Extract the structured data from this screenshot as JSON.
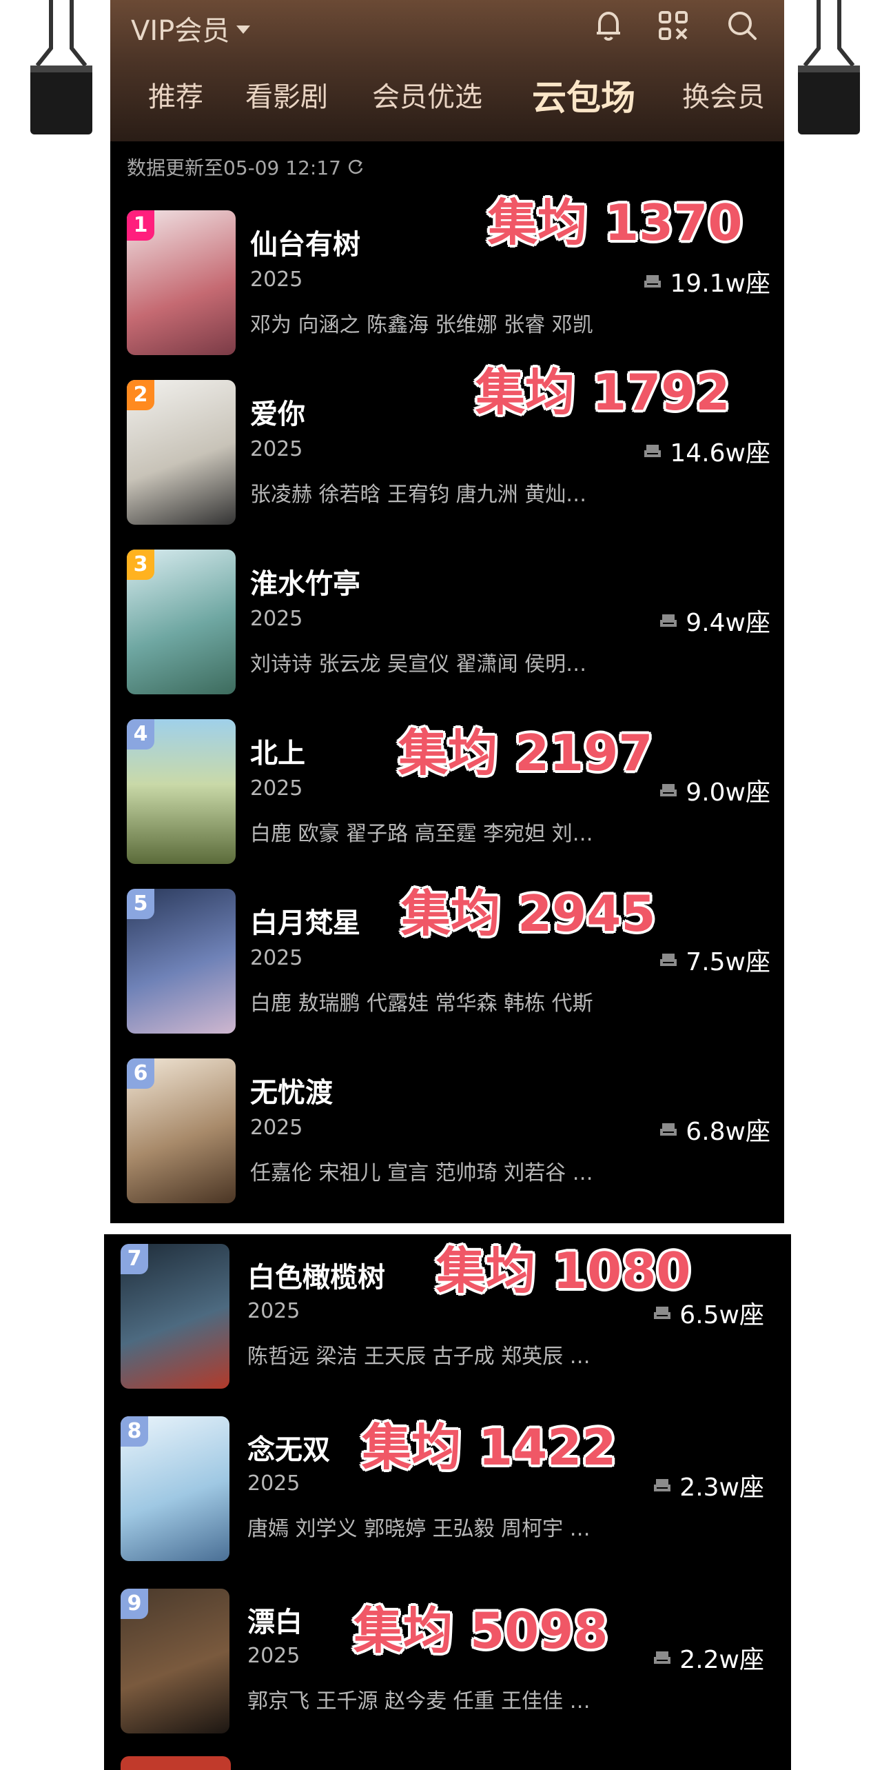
{
  "header": {
    "vip_label": "VIP会员",
    "tabs": [
      {
        "label": "推荐"
      },
      {
        "label": "看影剧"
      },
      {
        "label": "会员优选"
      },
      {
        "label": "云包场",
        "active": true
      },
      {
        "label": "换会员"
      }
    ],
    "icons": [
      "bell-icon",
      "scan-icon",
      "search-icon"
    ]
  },
  "updated_text": "数据更新至05-09 12:17",
  "rank_colors": {
    "1": "#ff1f7d",
    "2": "#ff8a1f",
    "3": "#ffb21f",
    "other": "#8aa6e0"
  },
  "overlay_color": "#f05766",
  "items": [
    {
      "rank": "1",
      "title": "仙台有树",
      "year": "2025",
      "cast": "邓为 向涵之 陈鑫海 张维娜 张睿 邓凯",
      "seats": "19.1w座",
      "overlay": "集均 1370"
    },
    {
      "rank": "2",
      "title": "爱你",
      "year": "2025",
      "cast": "张凌赫 徐若晗 王宥钧 唐九洲 黄灿…",
      "seats": "14.6w座",
      "overlay": "集均 1792"
    },
    {
      "rank": "3",
      "title": "淮水竹亭",
      "year": "2025",
      "cast": "刘诗诗 张云龙 吴宣仪 翟潇闻 侯明…",
      "seats": "9.4w座",
      "overlay": ""
    },
    {
      "rank": "4",
      "title": "北上",
      "year": "2025",
      "cast": "白鹿 欧豪 翟子路 高至霆 李宛妲 刘…",
      "seats": "9.0w座",
      "overlay": "集均 2197"
    },
    {
      "rank": "5",
      "title": "白月梵星",
      "year": "2025",
      "cast": "白鹿 敖瑞鹏 代露娃 常华森 韩栋 代斯",
      "seats": "7.5w座",
      "overlay": "集均 2945"
    },
    {
      "rank": "6",
      "title": "无忧渡",
      "year": "2025",
      "cast": "任嘉伦 宋祖儿 宣言 范帅琦 刘若谷 …",
      "seats": "6.8w座",
      "overlay": ""
    },
    {
      "rank": "7",
      "title": "白色橄榄树",
      "year": "2025",
      "cast": "陈哲远 梁洁 王天辰 古子成 郑英辰 …",
      "seats": "6.5w座",
      "overlay": "集均 1080"
    },
    {
      "rank": "8",
      "title": "念无双",
      "year": "2025",
      "cast": "唐嫣 刘学义 郭晓婷 王弘毅 周柯宇 …",
      "seats": "2.3w座",
      "overlay": "集均 1422"
    },
    {
      "rank": "9",
      "title": "漂白",
      "year": "2025",
      "cast": "郭京飞 王千源 赵今麦 任重 王佳佳 …",
      "seats": "2.2w座",
      "overlay": "集均 5098"
    }
  ]
}
